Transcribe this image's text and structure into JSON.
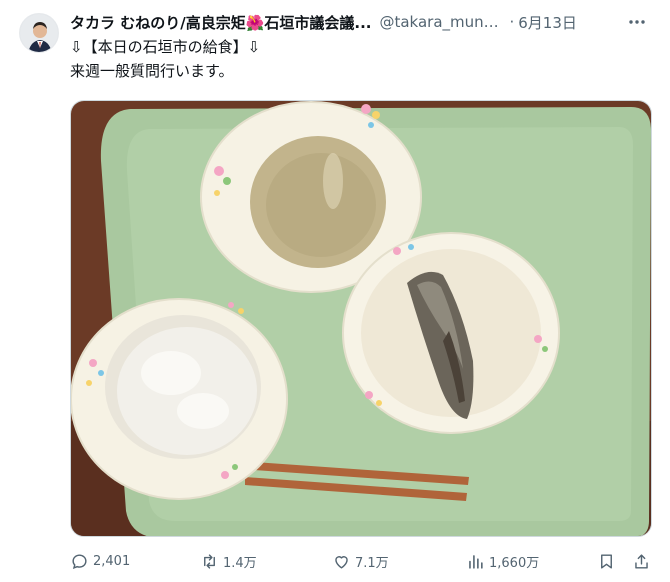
{
  "post": {
    "display_name": "タカラ むねのり/高良宗矩🌺石垣市議会議...",
    "handle": "@takara_mune...",
    "separator": "·",
    "date": "6月13日",
    "text_line1": "⇩【本日の石垣市の給食】⇩",
    "text_line2": "来週一般質問行います。"
  },
  "actions": {
    "replies": "2,401",
    "retweets": "1.4万",
    "likes": "7.1万",
    "views": "1,660万"
  },
  "icons": [
    "avatar",
    "more-icon",
    "reply-icon",
    "retweet-icon",
    "like-icon",
    "views-icon",
    "bookmark-icon",
    "share-icon"
  ],
  "colors": {
    "text": "#0f1419",
    "secondary": "#536471",
    "border": "#cfd9de",
    "tray": "#a7c9a0"
  }
}
